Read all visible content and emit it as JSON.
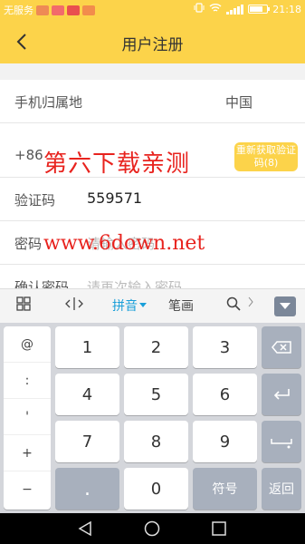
{
  "status_bar": {
    "carrier": "无服务",
    "time": "21:18",
    "notification_colors": [
      "#ee8a55",
      "#f26b6b",
      "#e94f4f",
      "#f28c4c"
    ],
    "battery_level": 0.75
  },
  "header": {
    "title": "用户注册",
    "back_icon": "chevron-left-icon"
  },
  "form": {
    "region": {
      "label": "手机归属地",
      "value": "中国"
    },
    "phone": {
      "prefix": "+86",
      "get_code_label": "重新获取验证码(8)"
    },
    "code": {
      "label": "验证码",
      "value": "559571"
    },
    "password": {
      "label": "密码",
      "placeholder": "请输入密码"
    },
    "confirm": {
      "label": "确认密码",
      "placeholder": "请再次输入密码"
    }
  },
  "watermark": {
    "line1": "第六下载亲测",
    "line2": "www.6down.net"
  },
  "keyboard": {
    "toolbar": {
      "pinyin": "拼音",
      "stroke": "笔画"
    },
    "symbols": [
      "@",
      ":",
      "'",
      "+",
      "−"
    ],
    "digits": [
      [
        "1",
        "2",
        "3"
      ],
      [
        "4",
        "5",
        "6"
      ],
      [
        "7",
        "8",
        "9"
      ]
    ],
    "dot": ".",
    "zero": "0",
    "symbol_key": "符号",
    "return_key": "返回"
  },
  "colors": {
    "accent": "#fcd34a",
    "watermark": "#e8231e",
    "keyboard_selected": "#1a9fd9"
  }
}
